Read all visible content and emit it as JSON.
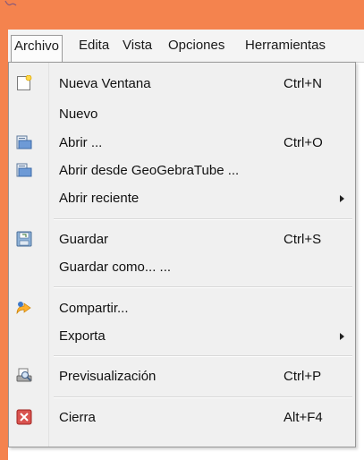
{
  "menubar": {
    "items": [
      "Archivo",
      "Edita",
      "Vista",
      "Opciones",
      "Herramientas"
    ]
  },
  "menu": {
    "items": [
      {
        "label": "Nueva Ventana",
        "shortcut": "Ctrl+N",
        "icon": "new-window-icon"
      },
      {
        "label": "Nuevo",
        "shortcut": "",
        "icon": ""
      },
      {
        "label": "Abrir ...",
        "shortcut": "Ctrl+O",
        "icon": "folder-icon"
      },
      {
        "label": "Abrir desde GeoGebraTube ...",
        "shortcut": "",
        "icon": "folder-icon"
      },
      {
        "label": "Abrir reciente",
        "shortcut": "",
        "icon": "",
        "submenu": true
      },
      {
        "label": "Guardar",
        "shortcut": "Ctrl+S",
        "icon": "save-icon"
      },
      {
        "label": "Guardar como... ...",
        "shortcut": "",
        "icon": ""
      },
      {
        "label": "Compartir...",
        "shortcut": "",
        "icon": "share-icon"
      },
      {
        "label": "Exporta",
        "shortcut": "",
        "icon": "",
        "submenu": true
      },
      {
        "label": "Previsualización",
        "shortcut": "Ctrl+P",
        "icon": "print-preview-icon"
      },
      {
        "label": "Cierra",
        "shortcut": "Alt+F4",
        "icon": "close-icon"
      }
    ]
  },
  "colors": {
    "titlebar": "#f4834e",
    "menu_bg": "#f0f0f0"
  }
}
